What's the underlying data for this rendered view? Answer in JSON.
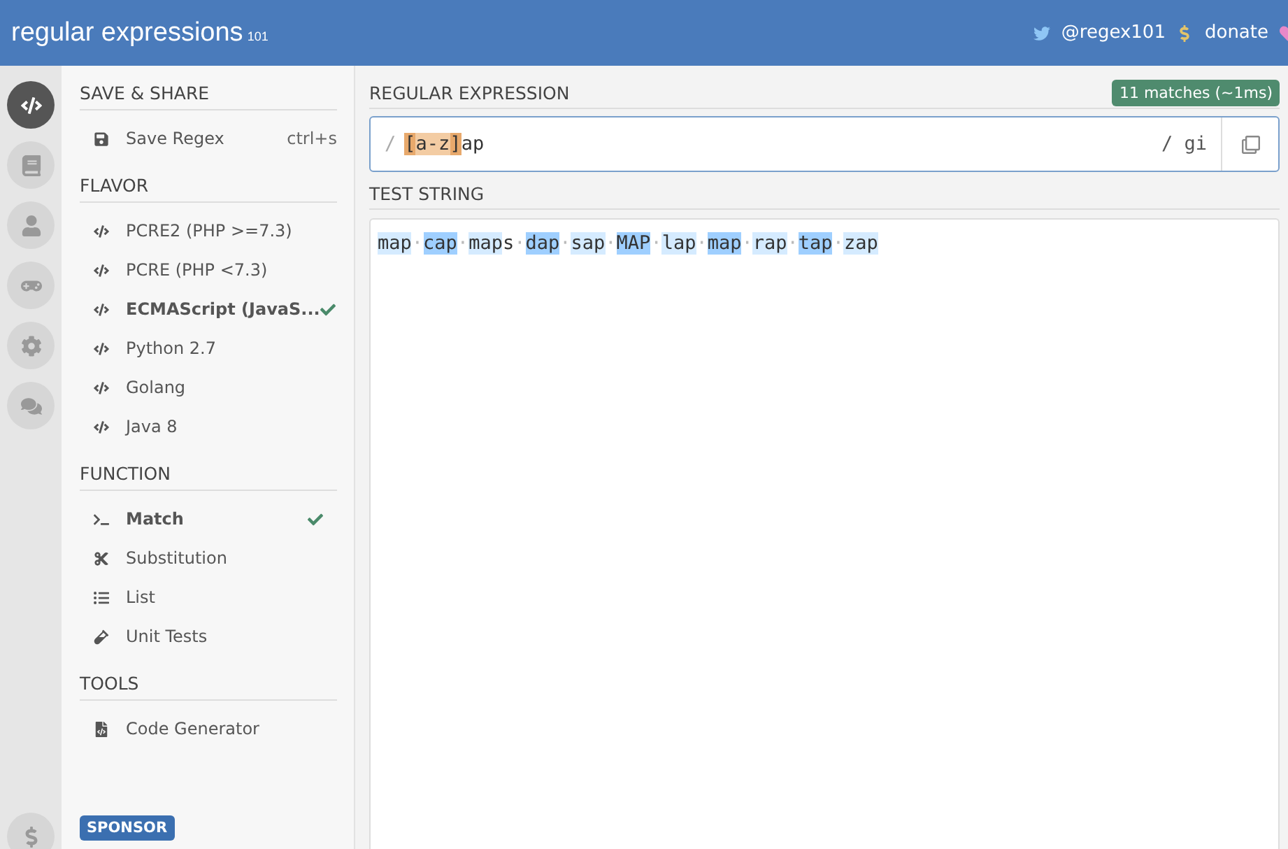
{
  "header": {
    "logo": "regular expressions",
    "logo_sub": "101",
    "links": [
      {
        "kind": "twitter",
        "label": "@regex101"
      },
      {
        "kind": "dollar",
        "label": "donate"
      },
      {
        "kind": "heart"
      }
    ]
  },
  "rail": [
    {
      "kind": "code",
      "selected": true
    },
    {
      "kind": "library",
      "selected": false
    },
    {
      "kind": "user",
      "selected": false
    },
    {
      "kind": "game",
      "selected": false
    },
    {
      "kind": "gear",
      "selected": false
    },
    {
      "kind": "chat",
      "selected": false
    }
  ],
  "rail_bottom": {
    "kind": "dollar"
  },
  "sidebar": {
    "sections": [
      {
        "title": "SAVE & SHARE",
        "items": [
          {
            "kind": "save",
            "label": "Save Regex",
            "shortcut": "ctrl+s",
            "selected": false
          }
        ]
      },
      {
        "title": "FLAVOR",
        "items": [
          {
            "kind": "code",
            "label": "PCRE2 (PHP >=7.3)",
            "selected": false
          },
          {
            "kind": "code",
            "label": "PCRE (PHP <7.3)",
            "selected": false
          },
          {
            "kind": "code",
            "label": "ECMAScript (JavaS...",
            "selected": true
          },
          {
            "kind": "code",
            "label": "Python 2.7",
            "selected": false
          },
          {
            "kind": "code",
            "label": "Golang",
            "selected": false
          },
          {
            "kind": "code",
            "label": "Java 8",
            "selected": false
          }
        ]
      },
      {
        "title": "FUNCTION",
        "items": [
          {
            "kind": "terminal",
            "label": "Match",
            "selected": true
          },
          {
            "kind": "scissors",
            "label": "Substitution",
            "selected": false
          },
          {
            "kind": "list",
            "label": "List",
            "selected": false
          },
          {
            "kind": "test",
            "label": "Unit Tests",
            "selected": false
          }
        ]
      },
      {
        "title": "TOOLS",
        "items": [
          {
            "kind": "file",
            "label": "Code Generator",
            "selected": false
          }
        ]
      }
    ],
    "sponsor": "SPONSOR"
  },
  "regex": {
    "title": "REGULAR EXPRESSION",
    "badge": "11 matches (~1ms)",
    "delimiter": "/",
    "segments": [
      {
        "text": "[",
        "kind": "bracket"
      },
      {
        "text": "a-z",
        "kind": "class"
      },
      {
        "text": "]",
        "kind": "bracket"
      },
      {
        "text": "ap",
        "kind": "plain"
      }
    ],
    "flags": "/ gi"
  },
  "test_string": {
    "title": "TEST STRING",
    "segments": [
      {
        "text": "map",
        "kind": "light"
      },
      {
        "text": "·",
        "kind": "space"
      },
      {
        "text": "cap",
        "kind": "dark"
      },
      {
        "text": "·",
        "kind": "space"
      },
      {
        "text": "map",
        "kind": "light"
      },
      {
        "text": "s",
        "kind": "plain"
      },
      {
        "text": "·",
        "kind": "space"
      },
      {
        "text": "dap",
        "kind": "dark"
      },
      {
        "text": "·",
        "kind": "space"
      },
      {
        "text": "sap",
        "kind": "light"
      },
      {
        "text": "·",
        "kind": "space"
      },
      {
        "text": "MAP",
        "kind": "dark"
      },
      {
        "text": "·",
        "kind": "space"
      },
      {
        "text": "lap",
        "kind": "light"
      },
      {
        "text": "·",
        "kind": "space"
      },
      {
        "text": "map",
        "kind": "dark"
      },
      {
        "text": "·",
        "kind": "space"
      },
      {
        "text": "rap",
        "kind": "light"
      },
      {
        "text": "·",
        "kind": "space"
      },
      {
        "text": "tap",
        "kind": "dark"
      },
      {
        "text": "·",
        "kind": "space"
      },
      {
        "text": "zap",
        "kind": "light"
      }
    ]
  }
}
